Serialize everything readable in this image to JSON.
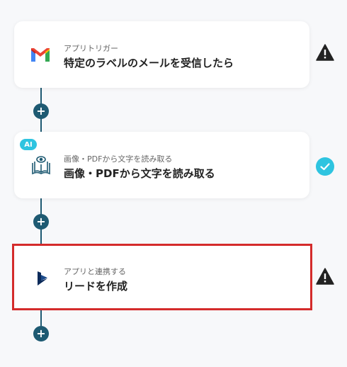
{
  "steps": [
    {
      "subtitle": "アプリトリガー",
      "title": "特定のラベルのメールを受信したら",
      "icon": "gmail-icon",
      "status": "warning"
    },
    {
      "subtitle": "画像・PDFから文字を読み取る",
      "title": "画像・PDFから文字を読み取る",
      "icon": "book-eye-icon",
      "badge": "AI",
      "status": "ok"
    },
    {
      "subtitle": "アプリと連携する",
      "title": "リードを作成",
      "icon": "dynamics-icon",
      "status": "warning",
      "selected": true
    }
  ],
  "add_button_label": "+",
  "colors": {
    "connector": "#1e5a72",
    "warning": "#222222",
    "ok": "#2ec4e0",
    "selected_border": "#d42b2b"
  }
}
